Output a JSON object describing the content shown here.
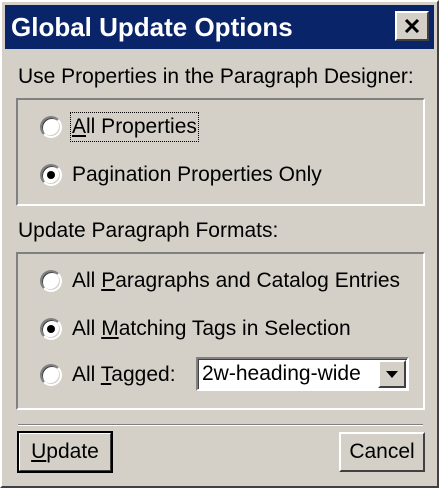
{
  "window": {
    "title": "Global Update Options"
  },
  "properties_section": {
    "label": "Use Properties in the Paragraph Designer:",
    "options": [
      {
        "pre": "",
        "u": "A",
        "post": "ll Properties",
        "checked": false
      },
      {
        "pre": "",
        "u": "",
        "post": "Pagination Properties Only",
        "checked": true
      }
    ]
  },
  "formats_section": {
    "label": "Update Paragraph Formats:",
    "options": [
      {
        "pre": "All ",
        "u": "P",
        "post": "aragraphs and Catalog Entries",
        "checked": false
      },
      {
        "pre": "All ",
        "u": "M",
        "post": "atching Tags in Selection",
        "checked": true
      },
      {
        "pre": "All ",
        "u": "T",
        "post": "agged:",
        "checked": false
      }
    ],
    "tag_select": {
      "value": "2w-heading-wide"
    }
  },
  "buttons": {
    "update": {
      "u": "U",
      "post": "pdate"
    },
    "cancel": "Cancel"
  },
  "icons": {
    "close": "close-icon",
    "dropdown": "chevron-down-icon"
  },
  "colors": {
    "titlebar": "#0a246a",
    "face": "#d4d0c8"
  }
}
